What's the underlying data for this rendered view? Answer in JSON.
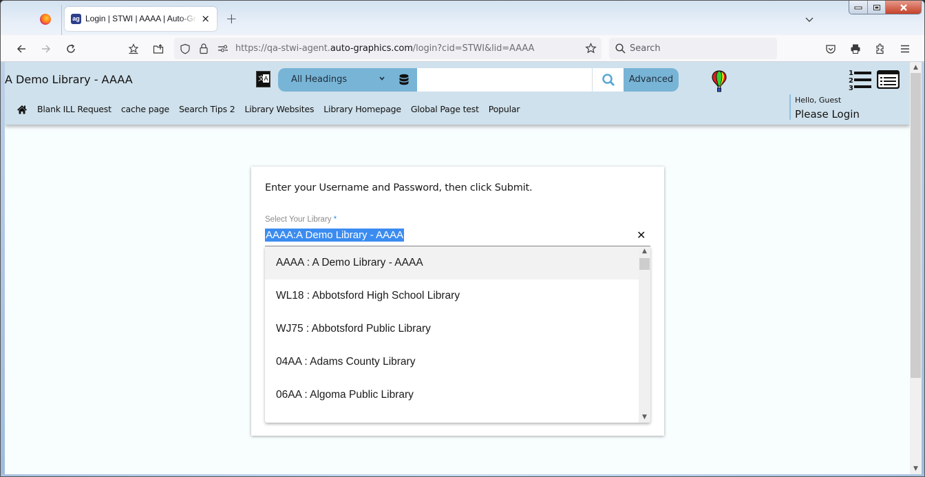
{
  "browser": {
    "tab": {
      "title": "Login | STWI | AAAA | Auto-Graphics",
      "favicon_text": "ag"
    },
    "new_tab_label": "+",
    "url": {
      "prefix": "https://qa-stwi-agent.",
      "domain": "auto-graphics.com",
      "path": "/login?cid=STWI&lid=AAAA"
    },
    "search_placeholder": "Search",
    "window_controls": {
      "minimize": "—",
      "maximize": "□",
      "close": "✕"
    }
  },
  "site": {
    "library_title": "A Demo Library - AAAA",
    "search": {
      "scope_selected": "All Headings",
      "query": "",
      "advanced_label": "Advanced"
    },
    "nav_links": [
      "Blank ILL Request",
      "cache page",
      "Search Tips 2",
      "Library Websites",
      "Library Homepage",
      "Global Page test",
      "Popular"
    ],
    "user": {
      "greeting": "Hello, Guest",
      "login_label": "Please Login"
    },
    "colors": {
      "header_bg": "#cfe1ec",
      "search_accent": "#78b4d6",
      "selection": "#3b8cf0"
    }
  },
  "login": {
    "instructions": "Enter your Username and Password, then click Submit.",
    "library_field": {
      "label": "Select Your Library",
      "required_mark": "*",
      "value": "AAAA:A Demo Library - AAAA",
      "clear_label": "✕"
    },
    "library_options": [
      "AAAA : A Demo Library - AAAA",
      "WL18 : Abbotsford High School Library",
      "WJ75 : Abbotsford Public Library",
      "04AA : Adams County Library",
      "06AA : Algoma Public Library"
    ],
    "highlighted_option_index": 0
  }
}
